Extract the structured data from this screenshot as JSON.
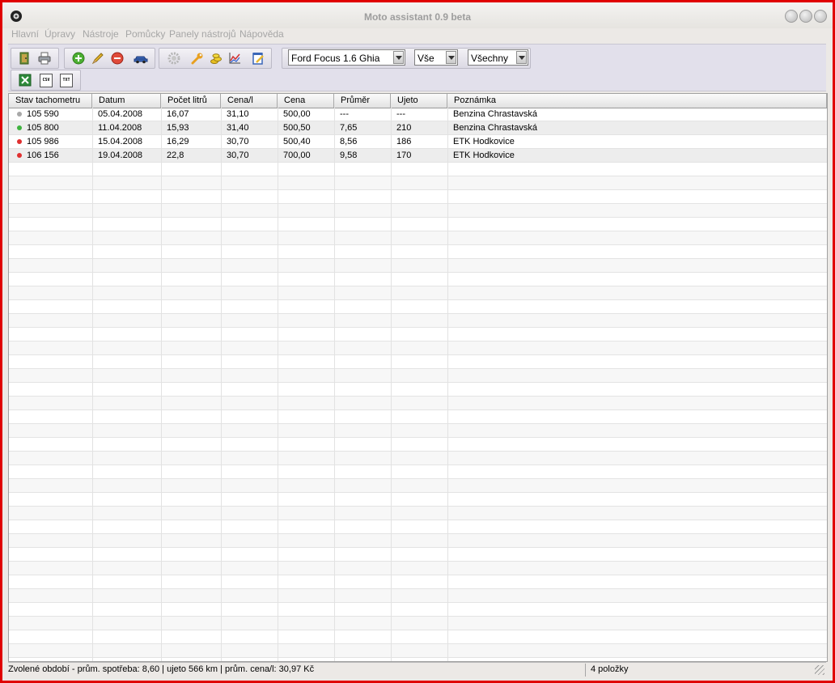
{
  "window": {
    "title": "Moto assistant 0.9 beta"
  },
  "menu": [
    "Hlavní",
    "Úpravy",
    "Nástroje",
    "Pomůcky",
    "Panely nástrojů",
    "Nápověda"
  ],
  "toolbar": {
    "vehicle": "Ford Focus 1.6 Ghia",
    "period": "Vše",
    "filter": "Všechny",
    "export": [
      "CSV",
      "TXT"
    ]
  },
  "table": {
    "columns": [
      "Stav tachometru",
      "Datum",
      "Počet litrů",
      "Cena/l",
      "Cena",
      "Průměr",
      "Ujeto",
      "Poznámka"
    ],
    "rows": [
      {
        "status": "#a8a8a8",
        "cells": [
          "105 590",
          "05.04.2008",
          "16,07",
          "31,10",
          "500,00",
          "---",
          "---",
          "Benzina Chrastavská"
        ]
      },
      {
        "status": "#3fb33f",
        "cells": [
          "105 800",
          "11.04.2008",
          "15,93",
          "31,40",
          "500,50",
          "7,65",
          "210",
          "Benzina Chrastavská"
        ]
      },
      {
        "status": "#e03030",
        "cells": [
          "105 986",
          "15.04.2008",
          "16,29",
          "30,70",
          "500,40",
          "8,56",
          "186",
          "ETK Hodkovice"
        ]
      },
      {
        "status": "#e03030",
        "cells": [
          "106 156",
          "19.04.2008",
          "22,8",
          "30,70",
          "700,00",
          "9,58",
          "170",
          "ETK Hodkovice"
        ]
      }
    ]
  },
  "status": {
    "summary": "Zvolené období - prům. spotřeba: 8,60 | ujeto 566 km | prům. cena/l: 30,97 Kč",
    "count": "4 položky"
  }
}
